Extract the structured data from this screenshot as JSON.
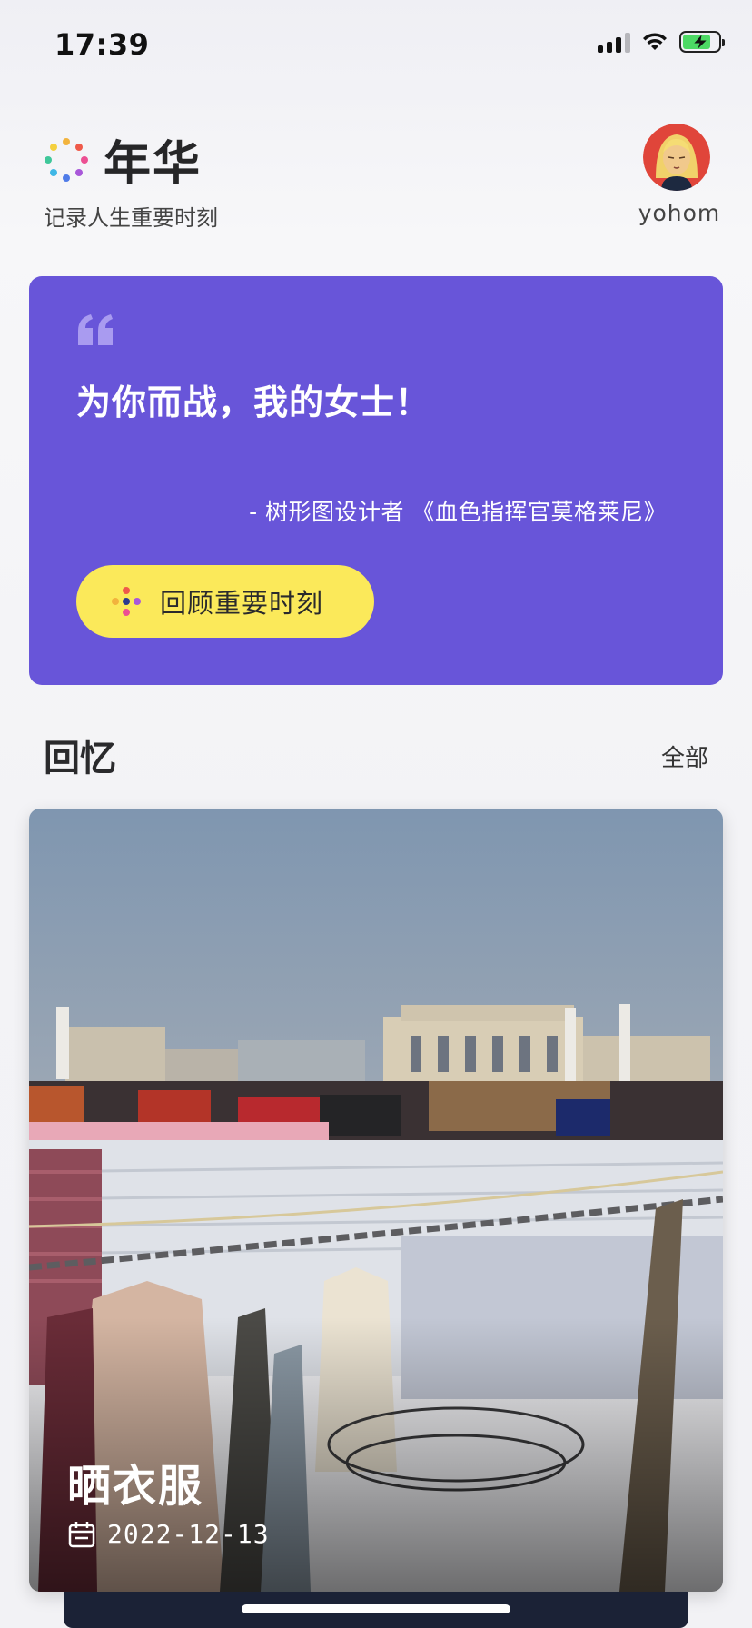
{
  "status_bar": {
    "time": "17:39",
    "battery_level": 0.8,
    "charging": true
  },
  "header": {
    "app_title": "年华",
    "app_subtitle": "记录人生重要时刻",
    "username": "yohom",
    "avatar_icon": "avatar-icon"
  },
  "quote_card": {
    "background_color": "#6855d9",
    "quote_icon": "quote-mark-icon",
    "quote": "为你而战，我的女士！",
    "source": "- 树形图设计者 《血色指挥官莫格莱尼》",
    "button": {
      "icon": "dots-icon",
      "label": "回顾重要时刻",
      "color": "#fbe95a"
    }
  },
  "memories": {
    "section_title": "回忆",
    "see_all_label": "全部",
    "items": [
      {
        "title": "晒衣服",
        "date": "2022-12-13",
        "date_icon": "calendar-icon"
      }
    ]
  }
}
